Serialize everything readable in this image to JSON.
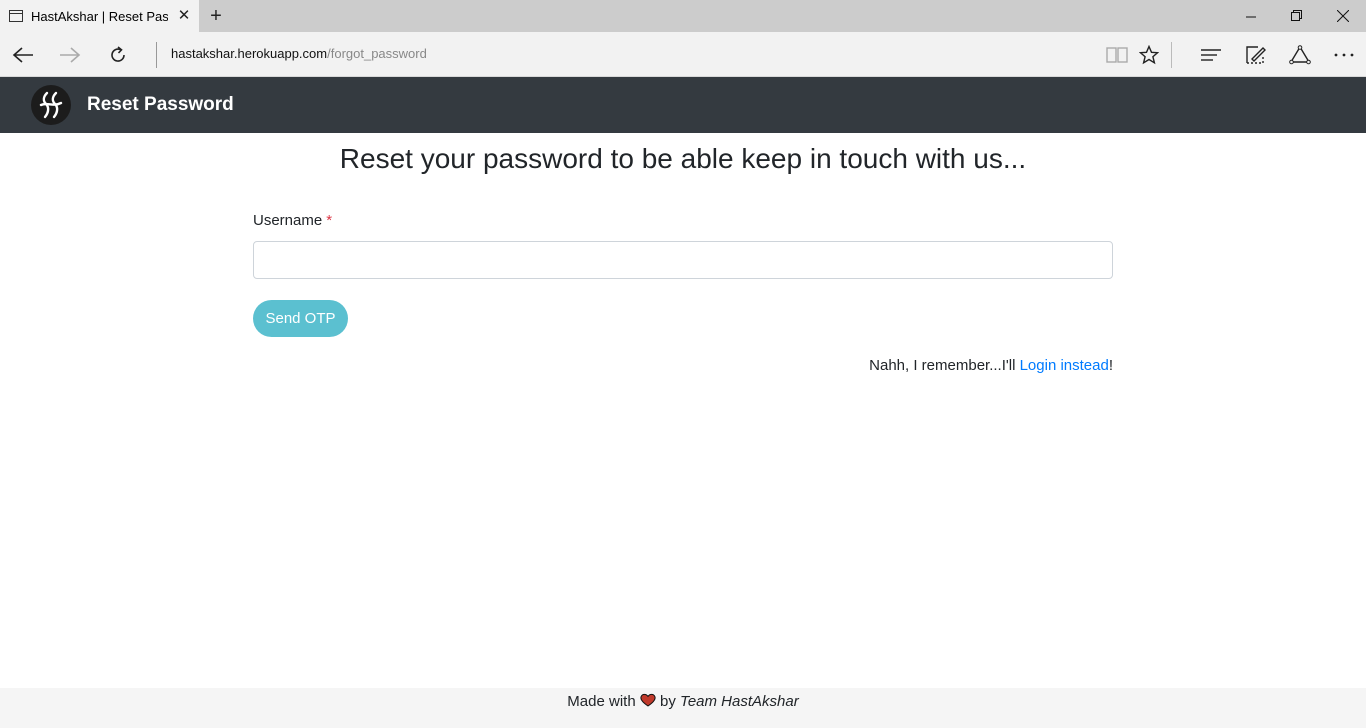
{
  "browser": {
    "tab_title": "HastAkshar | Reset Password",
    "address_host": "hastakshar.herokuapp.com",
    "address_path": "/forgot_password"
  },
  "header": {
    "brand": "Reset Password"
  },
  "main": {
    "heading": "Reset your password to be able keep in touch with us...",
    "username_label": "Username",
    "required_mark": "*",
    "username_value": "",
    "send_button": "Send OTP",
    "login_prefix": "Nahh, I remember...I'll ",
    "login_link": "Login instead",
    "login_suffix": "!"
  },
  "footer": {
    "made_with": "Made with",
    "by": "by",
    "team": "Team HastAkshar"
  },
  "colors": {
    "header_bg": "#343a40",
    "button_bg": "#5bc0d0",
    "link": "#007bff",
    "required": "#dc3545",
    "heart": "#c0392b"
  }
}
